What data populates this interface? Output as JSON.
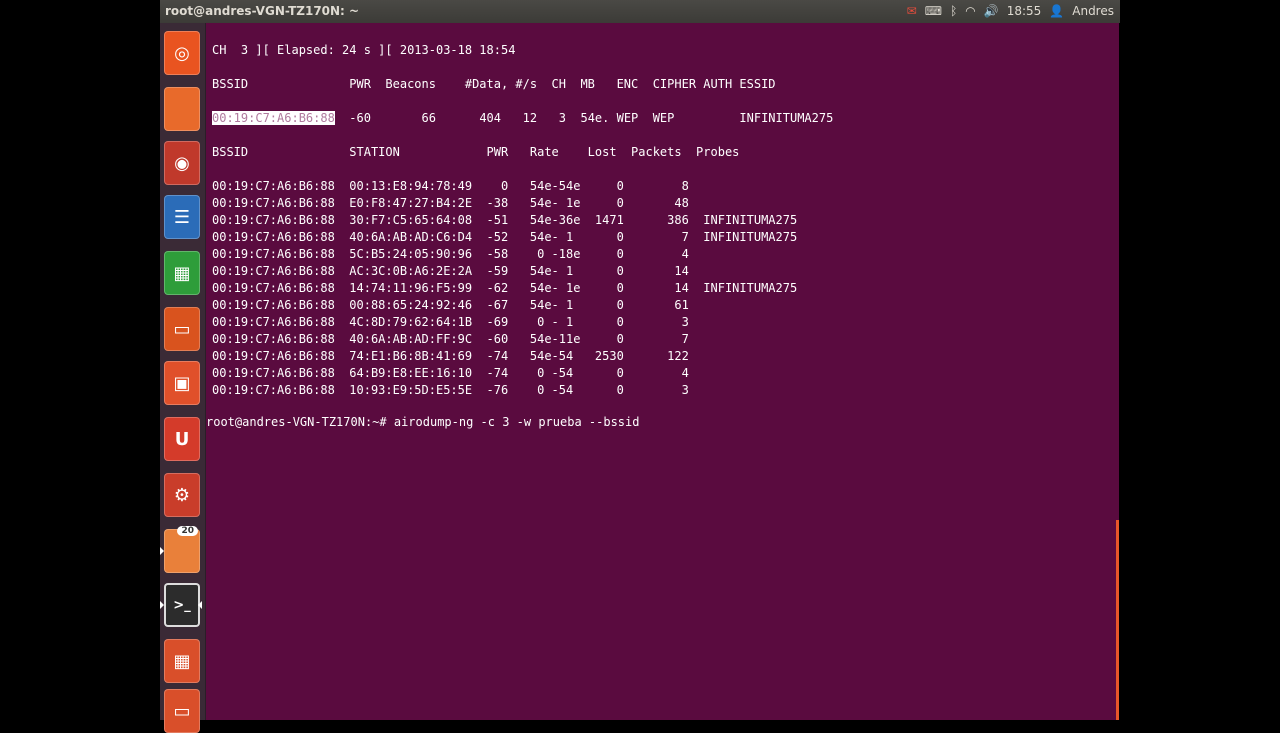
{
  "panel": {
    "title": "root@andres-VGN-TZ170N: ~",
    "time": "18:55",
    "user": "Andres",
    "icons": [
      "mail-icon",
      "keyboard-icon",
      "bluetooth-icon",
      "wifi-icon",
      "volume-icon",
      "user-icon"
    ]
  },
  "launcher": {
    "items": [
      {
        "name": "dash-home",
        "color": "#e95420",
        "glyph": "◎"
      },
      {
        "name": "files",
        "color": "#e86a2b",
        "glyph": ""
      },
      {
        "name": "firefox",
        "color": "#c0392b",
        "glyph": "◉"
      },
      {
        "name": "libreoffice-writer",
        "color": "#2b6cb8",
        "glyph": "☰"
      },
      {
        "name": "libreoffice-calc",
        "color": "#2e9d3a",
        "glyph": "▦"
      },
      {
        "name": "libreoffice-impress",
        "color": "#d9531e",
        "glyph": "▭"
      },
      {
        "name": "ubuntu-software-center",
        "color": "#e0502a",
        "glyph": "▣"
      },
      {
        "name": "ubuntu-one",
        "color": "#d43b2a",
        "glyph": "U"
      },
      {
        "name": "system-settings",
        "color": "#c93d2a",
        "glyph": "⚙"
      },
      {
        "name": "update-manager",
        "color": "#e9803a",
        "glyph": "",
        "badge": "20"
      },
      {
        "name": "terminal",
        "color": "#2c2c2c",
        "glyph": ">_"
      },
      {
        "name": "workspace-switcher",
        "color": "#d94f2a",
        "glyph": "▦"
      },
      {
        "name": "trash",
        "color": "#d94f2a",
        "glyph": "▭"
      }
    ]
  },
  "terminal": {
    "status_line": "CH  3 ][ Elapsed: 24 s ][ 2013-03-18 18:54",
    "ap_header": "BSSID              PWR  Beacons    #Data, #/s  CH  MB   ENC  CIPHER AUTH ESSID",
    "ap_row_bssid": "00:19:C7:A6:B6:88",
    "ap_row_rest": "  -60       66      404   12   3  54e. WEP  WEP         INFINITUMA275",
    "station_header": "BSSID              STATION            PWR   Rate    Lost  Packets  Probes",
    "stations": [
      "00:19:C7:A6:B6:88  00:13:E8:94:78:49    0   54e-54e     0        8",
      "00:19:C7:A6:B6:88  E0:F8:47:27:B4:2E  -38   54e- 1e     0       48",
      "00:19:C7:A6:B6:88  30:F7:C5:65:64:08  -51   54e-36e  1471      386  INFINITUMA275",
      "00:19:C7:A6:B6:88  40:6A:AB:AD:C6:D4  -52   54e- 1      0        7  INFINITUMA275",
      "00:19:C7:A6:B6:88  5C:B5:24:05:90:96  -58    0 -18e     0        4",
      "00:19:C7:A6:B6:88  AC:3C:0B:A6:2E:2A  -59   54e- 1      0       14",
      "00:19:C7:A6:B6:88  14:74:11:96:F5:99  -62   54e- 1e     0       14  INFINITUMA275",
      "00:19:C7:A6:B6:88  00:88:65:24:92:46  -67   54e- 1      0       61",
      "00:19:C7:A6:B6:88  4C:8D:79:62:64:1B  -69    0 - 1      0        3",
      "00:19:C7:A6:B6:88  40:6A:AB:AD:FF:9C  -60   54e-11e     0        7",
      "00:19:C7:A6:B6:88  74:E1:B6:8B:41:69  -74   54e-54   2530      122",
      "00:19:C7:A6:B6:88  64:B9:E8:EE:16:10  -74    0 -54      0        4",
      "00:19:C7:A6:B6:88  10:93:E9:5D:E5:5E  -76    0 -54      0        3"
    ],
    "prompt": "root@andres-VGN-TZ170N:~# airodump-ng -c 3 -w prueba --bssid"
  }
}
